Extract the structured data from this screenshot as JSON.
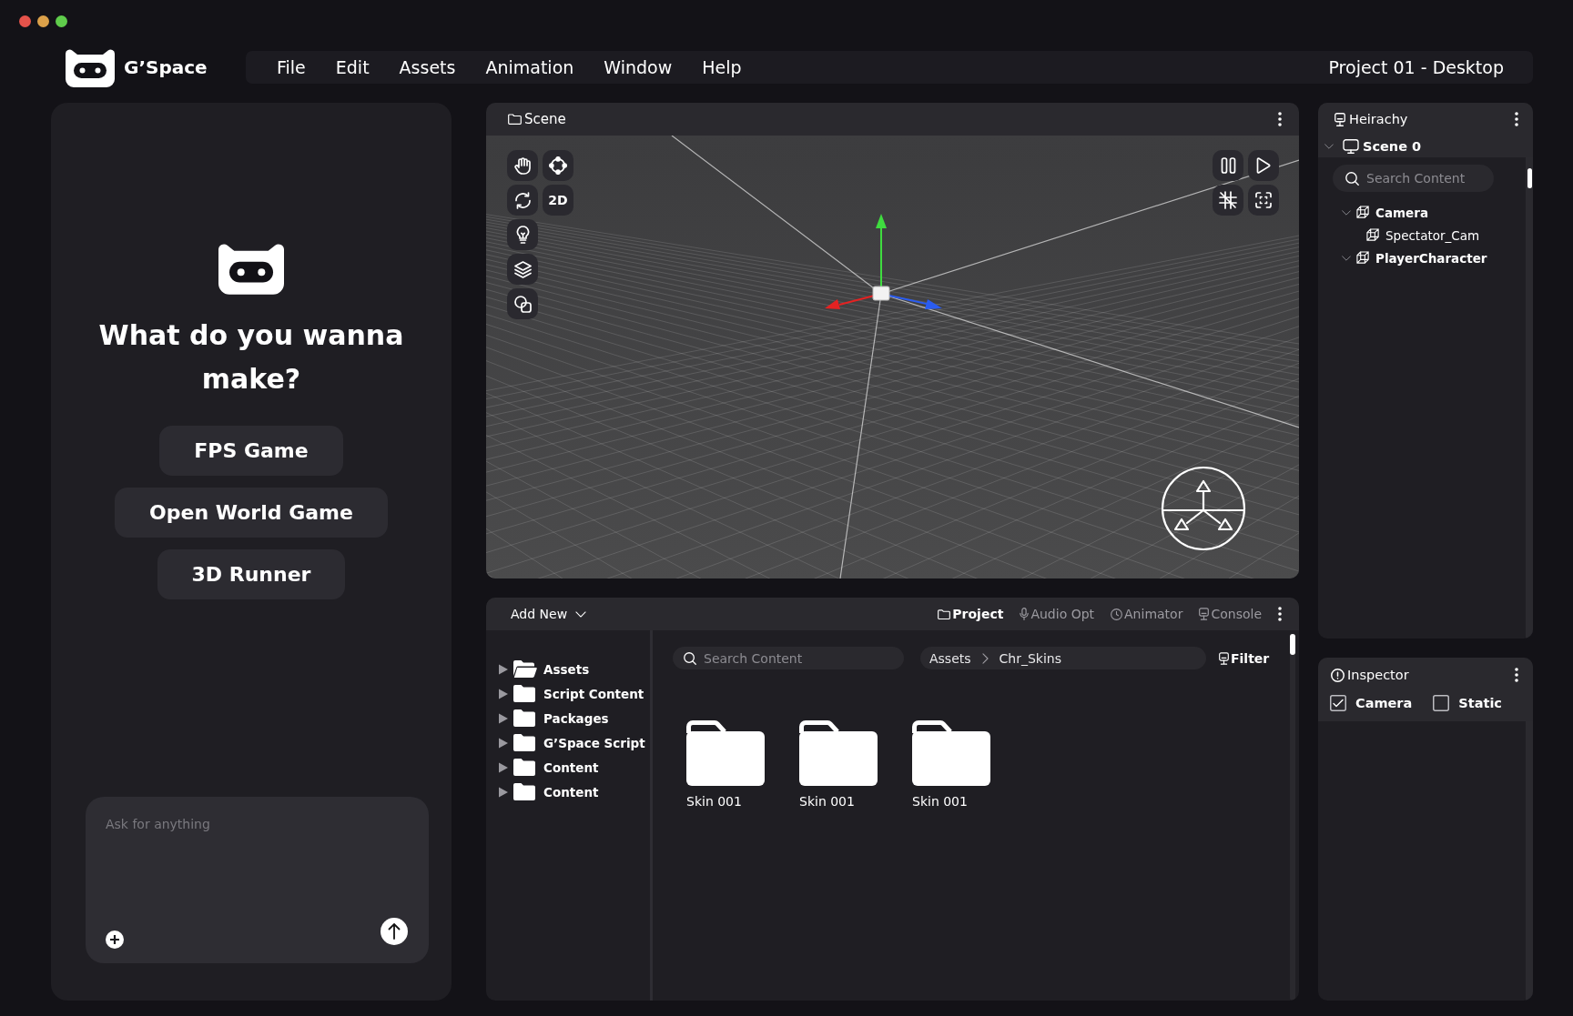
{
  "window": {
    "controls": [
      {
        "kind": "close",
        "color": "#e5534b"
      },
      {
        "kind": "minimize",
        "color": "#dca14a"
      },
      {
        "kind": "zoom",
        "color": "#5fcc4b"
      }
    ]
  },
  "header": {
    "app_name": "G’Space",
    "menu": [
      "File",
      "Edit",
      "Assets",
      "Animation",
      "Window",
      "Help"
    ],
    "project_title": "Project 01 - Desktop"
  },
  "assistant": {
    "heading": "What do you wanna make?",
    "suggestions": [
      "FPS Game",
      "Open World Game",
      "3D Runner"
    ],
    "prompt": {
      "placeholder": "Ask for anything"
    }
  },
  "scene": {
    "title": "Scene",
    "mode_toggle": "2D"
  },
  "project": {
    "add_new": "Add New",
    "tabs": [
      {
        "label": "Project",
        "selected": true
      },
      {
        "label": "Audio Opt",
        "selected": false
      },
      {
        "label": "Animator",
        "selected": false
      },
      {
        "label": "Console",
        "selected": false
      }
    ],
    "folders": [
      {
        "label": "Assets",
        "open": true,
        "expanded": false
      },
      {
        "label": "Script Content",
        "open": false,
        "expanded": false
      },
      {
        "label": "Packages",
        "open": false,
        "expanded": false
      },
      {
        "label": "G’Space Script",
        "open": false,
        "expanded": false
      },
      {
        "label": "Content",
        "open": false,
        "expanded": false
      },
      {
        "label": "Content",
        "open": false,
        "expanded": false
      }
    ],
    "search": {
      "placeholder": "Search Content"
    },
    "breadcrumb": [
      "Assets",
      "Chr_Skins"
    ],
    "filter": "Filter",
    "items": [
      "Skin 001",
      "Skin 001",
      "Skin 001"
    ]
  },
  "hierarchy": {
    "title": "Heirachy",
    "root": {
      "label": "Scene 0",
      "expanded": true
    },
    "search": {
      "placeholder": "Search Content"
    },
    "tree": [
      {
        "label": "Camera",
        "expanded": true,
        "children": [
          {
            "label": "Spectator_Cam"
          }
        ]
      },
      {
        "label": "PlayerCharacter",
        "expanded": true
      }
    ]
  },
  "inspector": {
    "title": "Inspector",
    "options": [
      {
        "label": "Camera",
        "checked": true
      },
      {
        "label": "Static",
        "checked": false
      }
    ]
  }
}
